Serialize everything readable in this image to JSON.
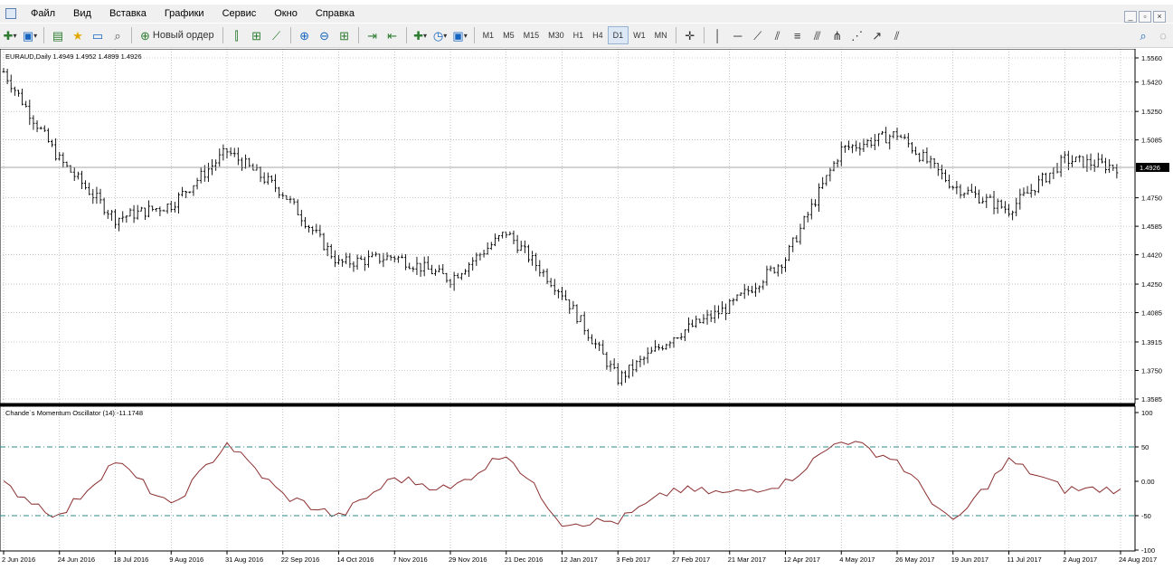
{
  "menu": {
    "items": [
      "Файл",
      "Вид",
      "Вставка",
      "Графики",
      "Сервис",
      "Окно",
      "Справка"
    ]
  },
  "window_controls": [
    "_",
    "▫",
    "×"
  ],
  "toolbar": {
    "new_order_label": "Новый ордер",
    "timeframes": [
      "M1",
      "M5",
      "M15",
      "M30",
      "H1",
      "H4",
      "D1",
      "W1",
      "MN"
    ],
    "active_timeframe": "D1"
  },
  "main_chart": {
    "header": "EURAUD,Daily  1.4949 1.4952 1.4899 1.4926",
    "price_ticks": [
      "1.5560",
      "1.5420",
      "1.5250",
      "1.5085",
      "1.4750",
      "1.4585",
      "1.4420",
      "1.4250",
      "1.4085",
      "1.3915",
      "1.3750",
      "1.3585"
    ],
    "current_price": "1.4926"
  },
  "indicator": {
    "header": "Chande`s Momentum Oscillator (14) -11.1748",
    "ticks": [
      "100",
      "50",
      "0.00",
      "-50",
      "-100"
    ]
  },
  "date_labels": [
    "2 Jun 2016",
    "24 Jun 2016",
    "18 Jul 2016",
    "9 Aug 2016",
    "31 Aug 2016",
    "22 Sep 2016",
    "14 Oct 2016",
    "7 Nov 2016",
    "29 Nov 2016",
    "21 Dec 2016",
    "12 Jan 2017",
    "3 Feb 2017",
    "27 Feb 2017",
    "21 Mar 2017",
    "12 Apr 2017",
    "4 May 2017",
    "26 May 2017",
    "19 Jun 2017",
    "11 Jul 2017",
    "2 Aug 2017",
    "24 Aug 2017"
  ],
  "chart_data": [
    {
      "type": "ohlc",
      "series": [
        {
          "name": "EURAUD,Daily"
        }
      ],
      "x": [
        "2 Jun 2016",
        "24 Jun 2016",
        "18 Jul 2016",
        "9 Aug 2016",
        "31 Aug 2016",
        "22 Sep 2016",
        "14 Oct 2016",
        "7 Nov 2016",
        "29 Nov 2016",
        "21 Dec 2016",
        "12 Jan 2017",
        "3 Feb 2017",
        "27 Feb 2017",
        "21 Mar 2017",
        "12 Apr 2017",
        "4 May 2017",
        "26 May 2017",
        "19 Jun 2017",
        "11 Jul 2017",
        "2 Aug 2017",
        "24 Aug 2017"
      ],
      "close": [
        1.548,
        1.497,
        1.463,
        1.471,
        1.502,
        1.478,
        1.437,
        1.441,
        1.428,
        1.455,
        1.42,
        1.37,
        1.395,
        1.412,
        1.44,
        1.503,
        1.512,
        1.482,
        1.468,
        1.497,
        1.4926
      ],
      "ylim": [
        1.3585,
        1.556
      ],
      "last": {
        "open": 1.4949,
        "high": 1.4952,
        "low": 1.4899,
        "close": 1.4926
      }
    },
    {
      "type": "line",
      "series": [
        {
          "name": "Chande`s Momentum Oscillator (14)"
        }
      ],
      "x": [
        "2 Jun 2016",
        "24 Jun 2016",
        "18 Jul 2016",
        "9 Aug 2016",
        "31 Aug 2016",
        "22 Sep 2016",
        "14 Oct 2016",
        "7 Nov 2016",
        "29 Nov 2016",
        "21 Dec 2016",
        "12 Jan 2017",
        "3 Feb 2017",
        "27 Feb 2017",
        "21 Mar 2017",
        "12 Apr 2017",
        "4 May 2017",
        "26 May 2017",
        "19 Jun 2017",
        "11 Jul 2017",
        "2 Aug 2017",
        "24 Aug 2017"
      ],
      "values": [
        -5,
        -52,
        30,
        -38,
        56,
        -20,
        -52,
        5,
        -12,
        42,
        -60,
        -58,
        -12,
        -18,
        -2,
        62,
        30,
        -62,
        30,
        -12,
        -11.1748
      ],
      "ylim": [
        -100,
        100
      ],
      "levels": [
        50,
        -50
      ],
      "last_value": -11.1748
    }
  ]
}
